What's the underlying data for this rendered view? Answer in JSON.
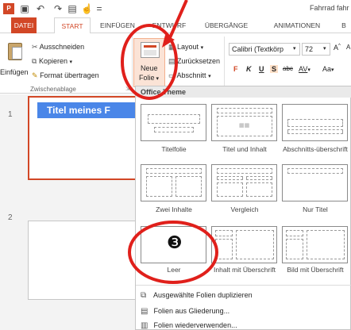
{
  "app": {
    "doc_title": "Fahrrad fahr"
  },
  "tabs": [
    {
      "label": "DATEI"
    },
    {
      "label": "START"
    },
    {
      "label": "EINFÜGEN"
    },
    {
      "label": "ENTWURF"
    },
    {
      "label": "ÜBERGÄNGE"
    },
    {
      "label": "ANIMATIONEN"
    },
    {
      "label": "B"
    }
  ],
  "clipboard": {
    "paste_label": "Einfügen",
    "cut_label": "Ausschneiden",
    "copy_label": "Kopieren",
    "format_painter_label": "Format übertragen",
    "group_label": "Zwischenablage"
  },
  "slides_group": {
    "new_slide_line1": "Neue",
    "new_slide_line2": "Folie",
    "layout_label": "Layout",
    "reset_label": "Zurücksetzen",
    "section_label": "Abschnitt"
  },
  "font": {
    "font_name": "Calibri (Textkörp",
    "font_size": "72",
    "bold": "F",
    "italic": "K",
    "underline": "U",
    "shadow": "S",
    "strike": "abc",
    "spacing": "AV",
    "case": "Aa"
  },
  "slide_panel": {
    "slide1_num": "1",
    "slide1_title": "Titel meines F",
    "slide2_num": "2"
  },
  "gallery": {
    "header": "Office Theme",
    "layouts": [
      {
        "label": "Titelfolie"
      },
      {
        "label": "Titel und Inhalt"
      },
      {
        "label": "Abschnitts-überschrift"
      },
      {
        "label": "Zwei Inhalte"
      },
      {
        "label": "Vergleich"
      },
      {
        "label": "Nur Titel"
      },
      {
        "label": "Leer"
      },
      {
        "label": "Inhalt mit Überschrift"
      },
      {
        "label": "Bild mit Überschrift"
      }
    ],
    "menu": [
      {
        "label": "Ausgewählte Folien duplizieren"
      },
      {
        "label": "Folien aus Gliederung..."
      },
      {
        "label": "Folien wiederverwenden..."
      }
    ]
  },
  "annotation": {
    "step_marker": "❸",
    "highlight_color": "#e0201b"
  }
}
